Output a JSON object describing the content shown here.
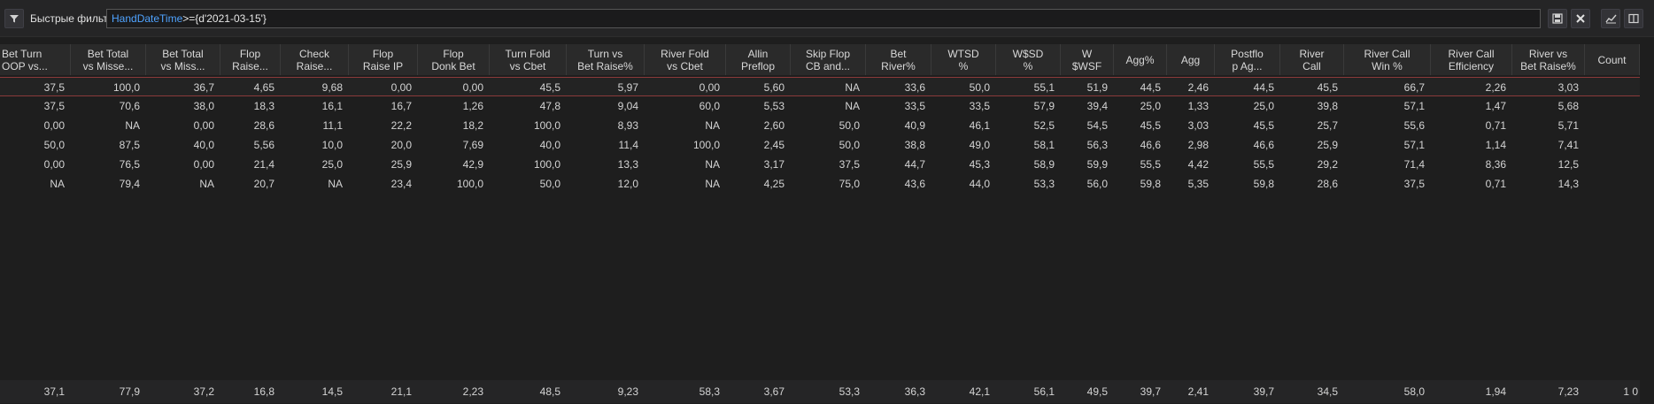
{
  "toolbar": {
    "filter_label": "Быстрые фильтры",
    "filter_field": "HandDateTime",
    "filter_expr": ">={d'2021-03-15'}"
  },
  "columns": [
    "Bet Turn\nOOP vs...",
    "Bet Total\nvs Misse...",
    "Bet Total\nvs Miss...",
    "Flop\nRaise...",
    "Check\nRaise...",
    "Flop\nRaise IP",
    "Flop\nDonk Bet",
    "Turn Fold\nvs Cbet",
    "Turn vs\nBet Raise%",
    "River Fold\nvs Cbet",
    "Allin\nPreflop",
    "Skip Flop\nCB and...",
    "Bet\nRiver%",
    "WTSD\n%",
    "W$SD\n%",
    "W\n$WSF",
    "Agg%",
    "Agg",
    "Postflo\np Ag...",
    "River\nCall",
    "River Call\nWin %",
    "River Call\nEfficiency",
    "River vs\nBet Raise%",
    "Count"
  ],
  "rows": [
    [
      "37,5",
      "100,0",
      "36,7",
      "4,65",
      "9,68",
      "0,00",
      "0,00",
      "45,5",
      "5,97",
      "0,00",
      "5,60",
      "NA",
      "33,6",
      "50,0",
      "55,1",
      "51,9",
      "44,5",
      "2,46",
      "44,5",
      "45,5",
      "66,7",
      "2,26",
      "3,03",
      ""
    ],
    [
      "37,5",
      "70,6",
      "38,0",
      "18,3",
      "16,1",
      "16,7",
      "1,26",
      "47,8",
      "9,04",
      "60,0",
      "5,53",
      "NA",
      "33,5",
      "33,5",
      "57,9",
      "39,4",
      "25,0",
      "1,33",
      "25,0",
      "39,8",
      "57,1",
      "1,47",
      "5,68",
      ""
    ],
    [
      "0,00",
      "NA",
      "0,00",
      "28,6",
      "11,1",
      "22,2",
      "18,2",
      "100,0",
      "8,93",
      "NA",
      "2,60",
      "50,0",
      "40,9",
      "46,1",
      "52,5",
      "54,5",
      "45,5",
      "3,03",
      "45,5",
      "25,7",
      "55,6",
      "0,71",
      "5,71",
      ""
    ],
    [
      "50,0",
      "87,5",
      "40,0",
      "5,56",
      "10,0",
      "20,0",
      "7,69",
      "40,0",
      "11,4",
      "100,0",
      "2,45",
      "50,0",
      "38,8",
      "49,0",
      "58,1",
      "56,3",
      "46,6",
      "2,98",
      "46,6",
      "25,9",
      "57,1",
      "1,14",
      "7,41",
      ""
    ],
    [
      "0,00",
      "76,5",
      "0,00",
      "21,4",
      "25,0",
      "25,9",
      "42,9",
      "100,0",
      "13,3",
      "NA",
      "3,17",
      "37,5",
      "44,7",
      "45,3",
      "58,9",
      "59,9",
      "55,5",
      "4,42",
      "55,5",
      "29,2",
      "71,4",
      "8,36",
      "12,5",
      ""
    ],
    [
      "NA",
      "79,4",
      "NA",
      "20,7",
      "NA",
      "23,4",
      "100,0",
      "50,0",
      "12,0",
      "NA",
      "4,25",
      "75,0",
      "43,6",
      "44,0",
      "53,3",
      "56,0",
      "59,8",
      "5,35",
      "59,8",
      "28,6",
      "37,5",
      "0,71",
      "14,3",
      ""
    ]
  ],
  "totals": [
    "37,1",
    "77,9",
    "37,2",
    "16,8",
    "14,5",
    "21,1",
    "2,23",
    "48,5",
    "9,23",
    "58,3",
    "3,67",
    "53,3",
    "36,3",
    "42,1",
    "56,1",
    "49,5",
    "39,7",
    "2,41",
    "39,7",
    "34,5",
    "58,0",
    "1,94",
    "7,23",
    "1 0"
  ]
}
